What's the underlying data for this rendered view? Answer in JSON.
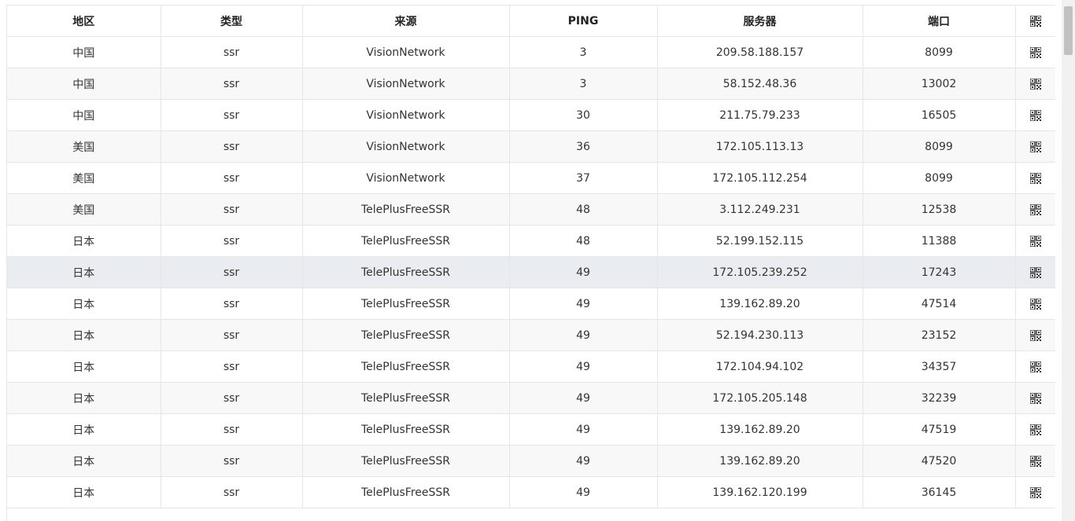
{
  "table": {
    "headers": [
      "地区",
      "类型",
      "来源",
      "PING",
      "服务器",
      "端口"
    ],
    "qr_header_icon": "qr-code-icon",
    "rows": [
      {
        "region": "中国",
        "type": "ssr",
        "source": "VisionNetwork",
        "ping": "3",
        "server": "209.58.188.157",
        "port": "8099"
      },
      {
        "region": "中国",
        "type": "ssr",
        "source": "VisionNetwork",
        "ping": "3",
        "server": "58.152.48.36",
        "port": "13002"
      },
      {
        "region": "中国",
        "type": "ssr",
        "source": "VisionNetwork",
        "ping": "30",
        "server": "211.75.79.233",
        "port": "16505"
      },
      {
        "region": "美国",
        "type": "ssr",
        "source": "VisionNetwork",
        "ping": "36",
        "server": "172.105.113.13",
        "port": "8099"
      },
      {
        "region": "美国",
        "type": "ssr",
        "source": "VisionNetwork",
        "ping": "37",
        "server": "172.105.112.254",
        "port": "8099"
      },
      {
        "region": "美国",
        "type": "ssr",
        "source": "TelePlusFreeSSR",
        "ping": "48",
        "server": "3.112.249.231",
        "port": "12538"
      },
      {
        "region": "日本",
        "type": "ssr",
        "source": "TelePlusFreeSSR",
        "ping": "48",
        "server": "52.199.152.115",
        "port": "11388"
      },
      {
        "region": "日本",
        "type": "ssr",
        "source": "TelePlusFreeSSR",
        "ping": "49",
        "server": "172.105.239.252",
        "port": "17243"
      },
      {
        "region": "日本",
        "type": "ssr",
        "source": "TelePlusFreeSSR",
        "ping": "49",
        "server": "139.162.89.20",
        "port": "47514"
      },
      {
        "region": "日本",
        "type": "ssr",
        "source": "TelePlusFreeSSR",
        "ping": "49",
        "server": "52.194.230.113",
        "port": "23152"
      },
      {
        "region": "日本",
        "type": "ssr",
        "source": "TelePlusFreeSSR",
        "ping": "49",
        "server": "172.104.94.102",
        "port": "34357"
      },
      {
        "region": "日本",
        "type": "ssr",
        "source": "TelePlusFreeSSR",
        "ping": "49",
        "server": "172.105.205.148",
        "port": "32239"
      },
      {
        "region": "日本",
        "type": "ssr",
        "source": "TelePlusFreeSSR",
        "ping": "49",
        "server": "139.162.89.20",
        "port": "47519"
      },
      {
        "region": "日本",
        "type": "ssr",
        "source": "TelePlusFreeSSR",
        "ping": "49",
        "server": "139.162.89.20",
        "port": "47520"
      },
      {
        "region": "日本",
        "type": "ssr",
        "source": "TelePlusFreeSSR",
        "ping": "49",
        "server": "139.162.120.199",
        "port": "36145"
      }
    ],
    "highlighted_row_index": 7
  },
  "colors": {
    "border": "#e6e6e6",
    "row_stripe": "#f8f8f8",
    "row_hover": "#e9edf2",
    "text": "#333333"
  }
}
